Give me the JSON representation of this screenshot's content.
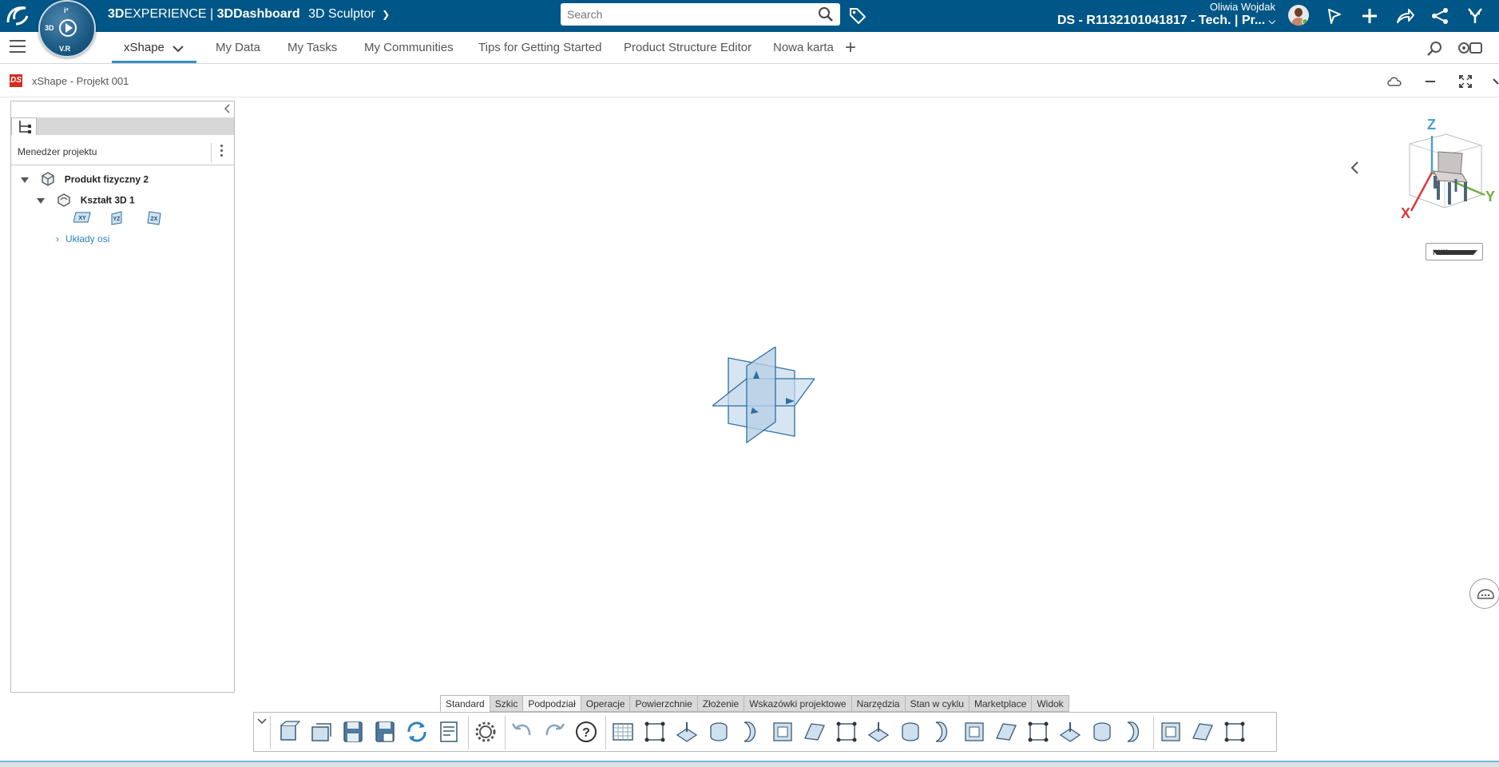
{
  "topbar": {
    "brand_prefix": "3D",
    "brand_experience": "EXPERIENCE",
    "brand_sep": " | ",
    "brand_dashboard": "3DDashboard",
    "app_name": "3D Sculptor",
    "compass_labels": [
      "3D",
      "V.R",
      "i³"
    ],
    "search_placeholder": "Search",
    "user_name": "Oliwia Wojdak",
    "context": "DS - R1132101041817 - Tech. | Pr..."
  },
  "tabs": [
    {
      "label": "xShape"
    },
    {
      "label": "My Data"
    },
    {
      "label": "My Tasks"
    },
    {
      "label": "My Communities"
    },
    {
      "label": "Tips for Getting Started"
    },
    {
      "label": "Product Structure Editor"
    },
    {
      "label": "Nowa karta"
    }
  ],
  "widget": {
    "title": "xShape - Projekt 001",
    "icon_text": "DS"
  },
  "panel": {
    "manager_title": "Menedżer projektu",
    "tree": {
      "root": "Produkt fizyczny 2",
      "child": "Kształt 3D 1",
      "planes": [
        "XY",
        "YZ",
        "ZX"
      ],
      "axes_folder": "Układy osi"
    }
  },
  "viewer": {
    "units": "mm",
    "axis_labels": {
      "z": "Z",
      "y": "Y",
      "x": "X"
    },
    "axis_colors": {
      "z": "#4a9fd0",
      "y": "#6bb03c",
      "x": "#d93a3a"
    }
  },
  "section_tabs": [
    "Standard",
    "Szkic",
    "Podpodział",
    "Operacje",
    "Powierzchnie",
    "Złożenie",
    "Wskazówki projektowe",
    "Narzędzia",
    "Stan w cyklu",
    "Marketplace",
    "Widok"
  ],
  "toolbar_icons": [
    "new-icon",
    "open-icon",
    "save-icon",
    "save-as-icon",
    "refresh-icon",
    "import-export-icon",
    "settings-icon",
    "undo-icon",
    "redo-icon",
    "help-icon",
    "grid-icon",
    "box-icon",
    "mesh-icon",
    "extrude-icon",
    "plane-icon",
    "cylinder-icon",
    "curve-icon",
    "face-icon",
    "sheet-icon",
    "vertex-icon",
    "surface-icon",
    "cube-shade-icon",
    "delete-box-icon",
    "pipe-icon",
    "sphere-icon",
    "blade-icon",
    "sweep-icon",
    "box-frame-icon",
    "mirror-icon",
    "network-icon"
  ],
  "colors": {
    "topbar": "#005686",
    "accent": "#368ec4",
    "plane_fill": "#c9dcee",
    "plane_stroke": "#2c6fa1"
  }
}
